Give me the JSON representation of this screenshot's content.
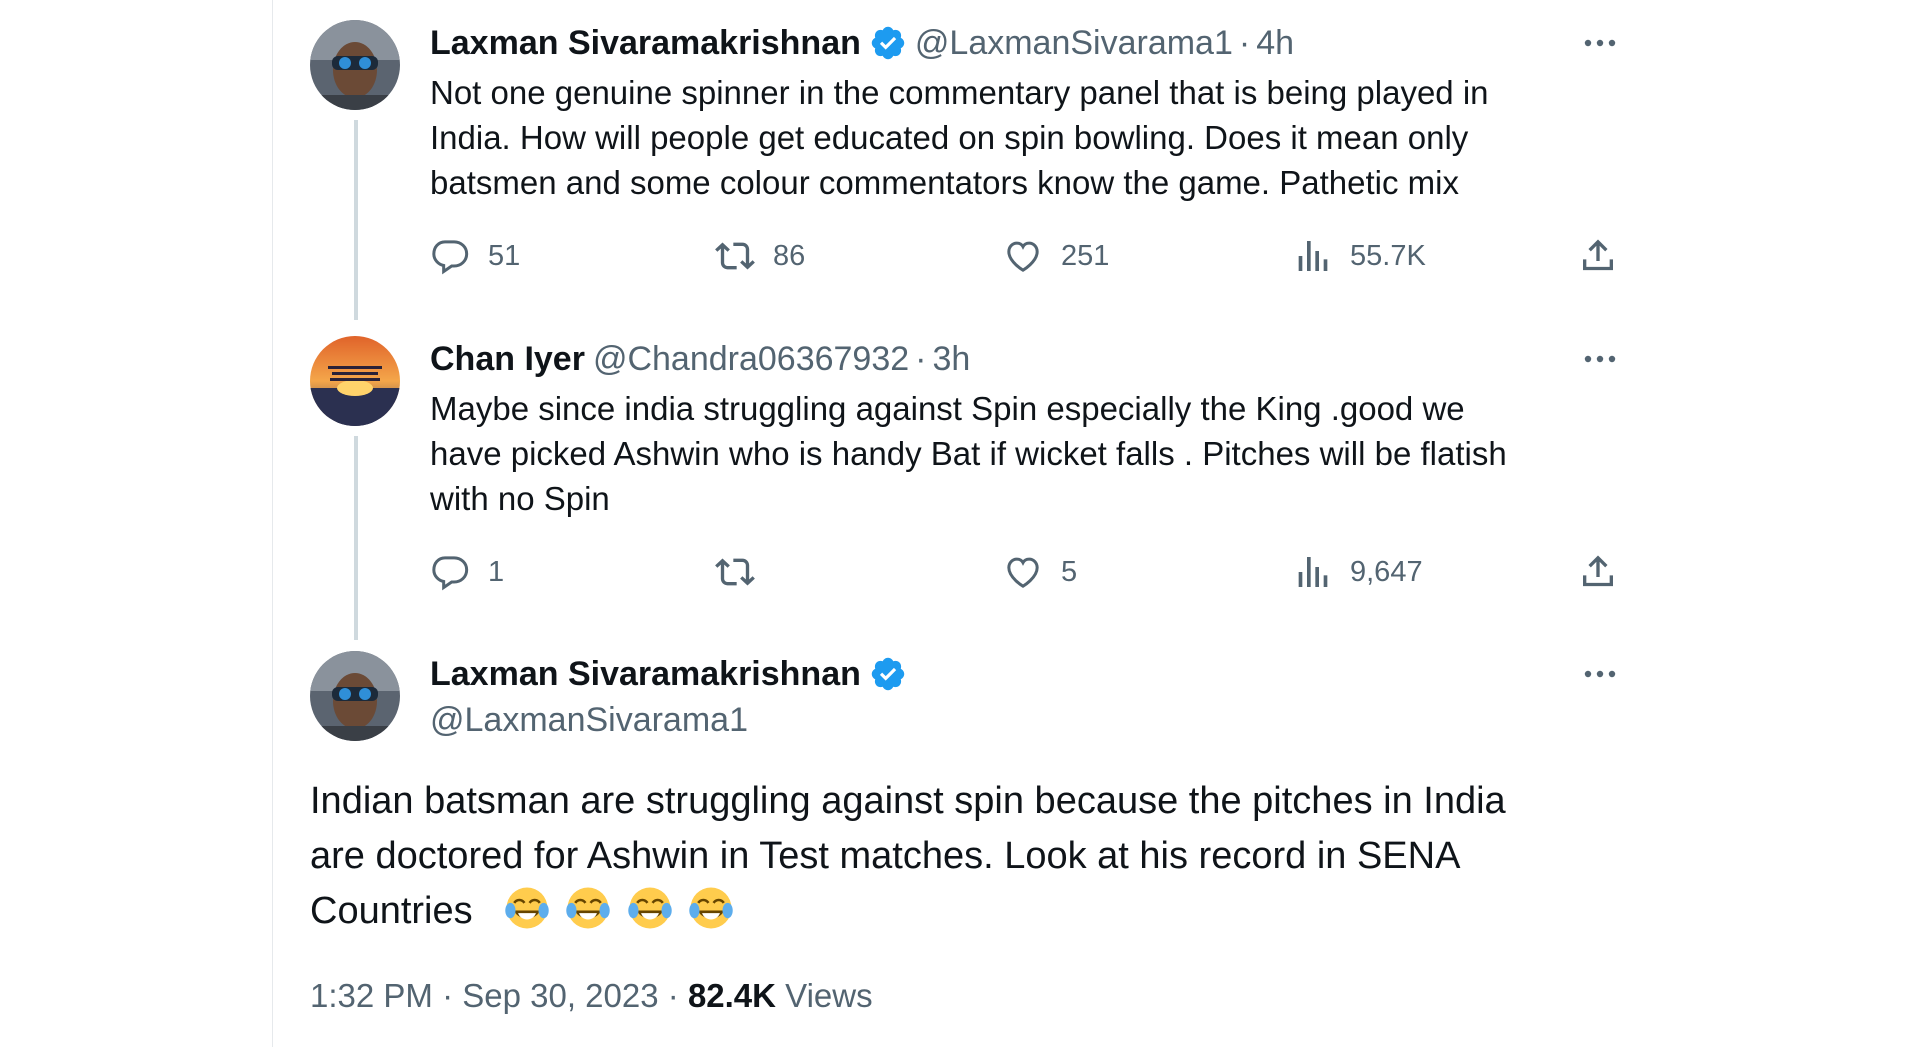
{
  "colors": {
    "verified": "#1d9bf0",
    "muted": "#536471",
    "text": "#0f1419",
    "thread_line": "#cfd9de"
  },
  "tweet1": {
    "name": "Laxman Sivaramakrishnan",
    "handle": "@LaxmanSivarama1",
    "separator": "·",
    "time": "4h",
    "text_lines": [
      "Not one genuine spinner in the commentary panel that is being played in",
      "India. How will people get educated on spin bowling. Does it mean only",
      "batsmen and some colour commentators know the game. Pathetic mix"
    ],
    "replies": "51",
    "retweets": "86",
    "likes": "251",
    "views": "55.7K"
  },
  "tweet2": {
    "name": "Chan Iyer",
    "handle": "@Chandra06367932",
    "separator": "·",
    "time": "3h",
    "text_lines": [
      "Maybe since india struggling against Spin especially the King .good we",
      "have picked Ashwin who is handy Bat if wicket falls  . Pitches will be flatish",
      "with no Spin"
    ],
    "replies": "1",
    "retweets": "",
    "likes": "5",
    "views": "9,647"
  },
  "main_tweet": {
    "name": "Laxman Sivaramakrishnan",
    "handle": "@LaxmanSivarama1",
    "text_lines": [
      "Indian batsman are struggling against spin because the pitches in India",
      "are doctored for Ashwin in Test matches. Look at his record in SENA"
    ],
    "last_line": "Countries",
    "emoji": [
      "face-with-tears-of-joy",
      "face-with-tears-of-joy",
      "face-with-tears-of-joy",
      "face-with-tears-of-joy"
    ],
    "time": "1:32 PM",
    "separator": "·",
    "date": "Sep 30, 2023",
    "views_count": "82.4K",
    "views_label": "Views"
  }
}
